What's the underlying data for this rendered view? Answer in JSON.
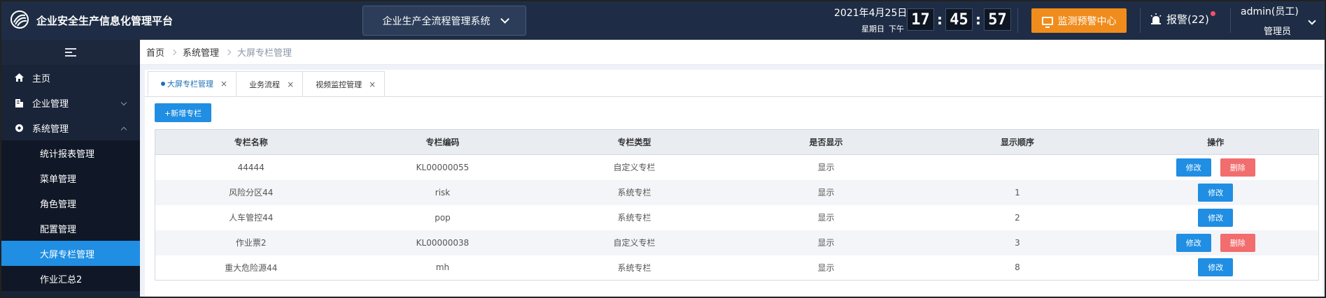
{
  "header": {
    "app_title": "企业安全生产信息化管理平台",
    "system_selector": "企业生产全流程管理系统",
    "date": "2021年4月25日",
    "weekday": "星期日",
    "period": "下午",
    "clock": {
      "hh": "17",
      "mm": "45",
      "ss": "57"
    },
    "monitor_button": "监测预警中心",
    "alarm_label": "报警(22)",
    "user_name": "admin(员工)",
    "user_role": "管理员",
    "colors": {
      "header_bg": "#1e2d45",
      "accent": "#f08c1c",
      "alarm_dot": "#f2506b"
    }
  },
  "sidebar": {
    "items": [
      {
        "label": "主页",
        "icon": "home-icon"
      },
      {
        "label": "企业管理",
        "icon": "building-icon"
      },
      {
        "label": "系统管理",
        "icon": "settings-icon"
      }
    ],
    "sub_items": [
      {
        "label": "统计报表管理"
      },
      {
        "label": "菜单管理"
      },
      {
        "label": "角色管理"
      },
      {
        "label": "配置管理"
      },
      {
        "label": "大屏专栏管理"
      },
      {
        "label": "作业汇总2"
      }
    ],
    "active_sub": "大屏专栏管理",
    "colors": {
      "active": "#1f8ee3"
    }
  },
  "breadcrumb": [
    "首页",
    "系统管理",
    "大屏专栏管理"
  ],
  "tabs": [
    {
      "label": "大屏专栏管理"
    },
    {
      "label": "业务流程"
    },
    {
      "label": "视频监控管理"
    }
  ],
  "toolbar": {
    "add_label": "+新增专栏"
  },
  "table": {
    "headers": [
      "专栏名称",
      "专栏编码",
      "专栏类型",
      "是否显示",
      "显示顺序",
      "操作"
    ],
    "rows": [
      {
        "name": "44444",
        "code": "KL00000055",
        "type": "自定义专栏",
        "shown": "显示",
        "order": "",
        "deletable": true
      },
      {
        "name": "风险分区44",
        "code": "risk",
        "type": "系统专栏",
        "shown": "显示",
        "order": "1",
        "deletable": false
      },
      {
        "name": "人车管控44",
        "code": "pop",
        "type": "系统专栏",
        "shown": "显示",
        "order": "2",
        "deletable": false
      },
      {
        "name": "作业票2",
        "code": "KL00000038",
        "type": "自定义专栏",
        "shown": "显示",
        "order": "3",
        "deletable": true
      },
      {
        "name": "重大危险源44",
        "code": "mh",
        "type": "系统专栏",
        "shown": "显示",
        "order": "8",
        "deletable": false
      }
    ],
    "edit_label": "修改",
    "delete_label": "删除"
  }
}
